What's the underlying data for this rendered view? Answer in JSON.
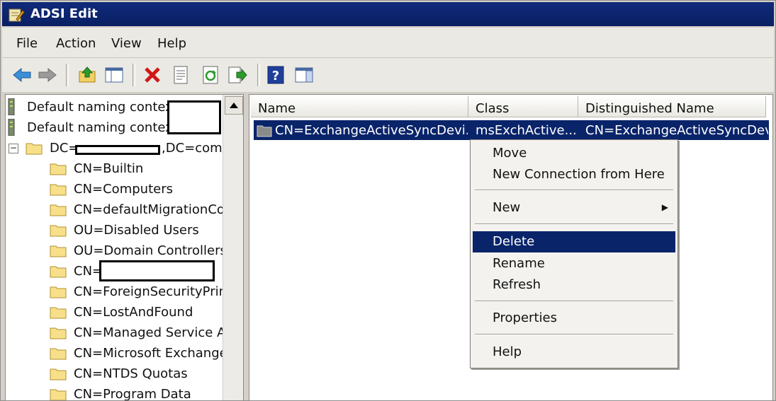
{
  "window": {
    "title": "ADSI Edit"
  },
  "menubar": {
    "items": [
      "File",
      "Action",
      "View",
      "Help"
    ]
  },
  "toolbar": {
    "buttons": [
      "back-icon",
      "forward-icon",
      "up-level-icon",
      "show-hide-tree-icon",
      "delete-icon",
      "properties-icon",
      "refresh-icon",
      "export-list-icon",
      "help-icon",
      "show-hide-action-pane-icon"
    ]
  },
  "tree": {
    "connections": [
      "Default naming context",
      "Default naming context"
    ],
    "root": {
      "prefix": "DC=",
      "suffix": ",DC=com",
      "expander": "−"
    },
    "children": [
      "CN=Builtin",
      "CN=Computers",
      "CN=defaultMigrationCont",
      "OU=Disabled Users",
      "OU=Domain Controllers",
      "CN=",
      "CN=ForeignSecurityPrinci",
      "CN=LostAndFound",
      "CN=Managed Service Acc",
      "CN=Microsoft Exchange S",
      "CN=NTDS Quotas",
      "CN=Program Data"
    ]
  },
  "list": {
    "columns": [
      "Name",
      "Class",
      "Distinguished Name"
    ],
    "rows": [
      {
        "name": "CN=ExchangeActiveSyncDevi...",
        "class": "msExchActive...",
        "dn": "CN=ExchangeActiveSyncDevic"
      }
    ]
  },
  "context_menu": {
    "items": [
      "Move",
      "New Connection from Here",
      "New",
      "Delete",
      "Rename",
      "Refresh",
      "Properties",
      "Help"
    ],
    "submenu_arrow": "▶",
    "active": "Delete"
  },
  "colors": {
    "titlebar": "#0a1f63",
    "selection": "#0a246a",
    "chrome": "#d4d0c8"
  }
}
